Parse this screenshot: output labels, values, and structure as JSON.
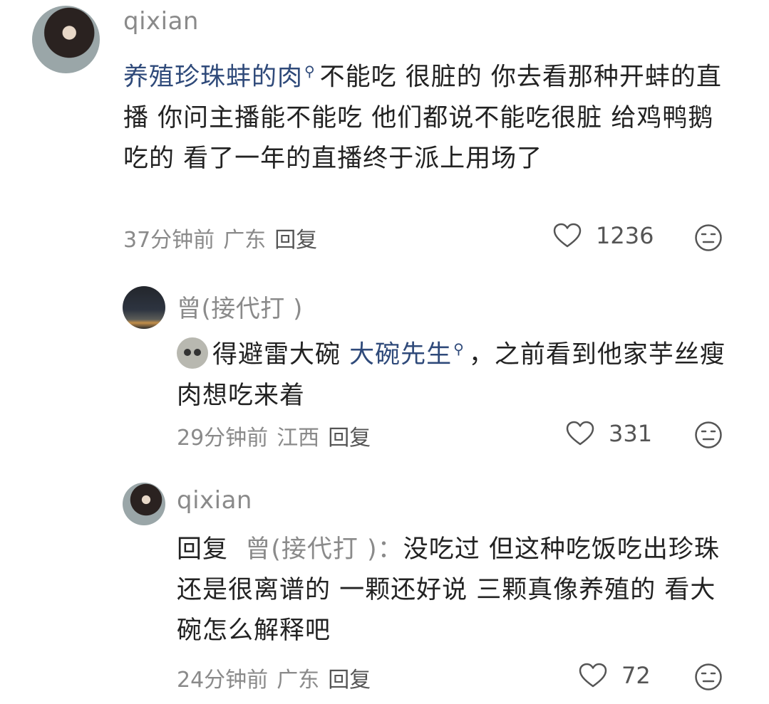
{
  "comments": [
    {
      "username": "qixian",
      "link_text": "养殖珍珠蚌的肉",
      "text": "不能吃 很脏的 你去看那种开蚌的直播 你问主播能不能吃 他们都说不能吃很脏 给鸡鸭鹅吃的  看了一年的直播终于派上用场了",
      "time": "37分钟前",
      "location": "广东",
      "reply_label": "回复",
      "likes": "1236"
    },
    {
      "username": "曾(接代打 )",
      "text_before": "得避雷大碗 ",
      "link_text": "大碗先生",
      "text_after": "，之前看到他家芋丝瘦肉想吃来着",
      "time": "29分钟前",
      "location": "江西",
      "reply_label": "回复",
      "likes": "331"
    },
    {
      "username": "qixian",
      "reply_prefix": "回复",
      "reply_to": "曾(接代打 )",
      "separator": "：",
      "text": "没吃过 但这种吃饭吃出珍珠还是很离谱的 一颗还好说 三颗真像养殖的 看大碗怎么解释吧",
      "time": "24分钟前",
      "location": "广东",
      "reply_label": "回复",
      "likes": "72"
    }
  ],
  "icons": {
    "search": "search-icon",
    "like": "heart-icon",
    "dislike": "dislike-face-icon",
    "emoji": "emoji-face-icon"
  },
  "colors": {
    "link": "#2f4a7a",
    "muted": "#8a8a8a",
    "text": "#222222"
  }
}
